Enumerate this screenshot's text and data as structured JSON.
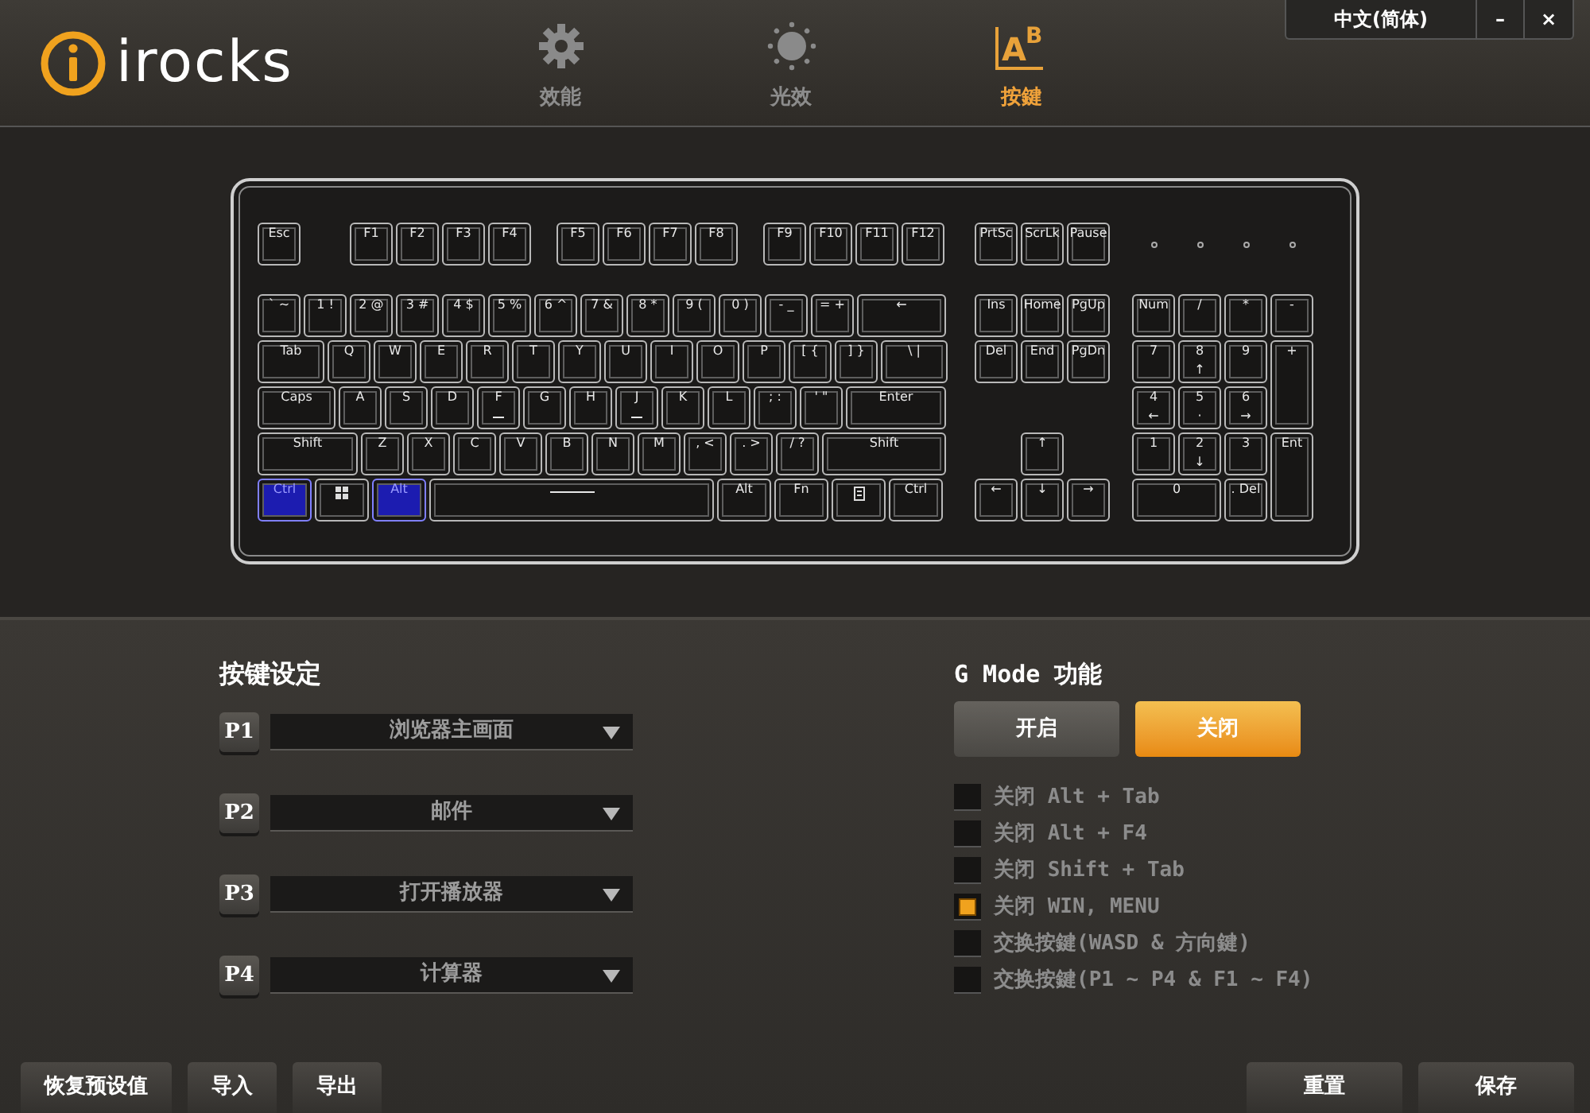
{
  "header": {
    "logo_text": "irocks",
    "tabs": [
      {
        "label": "效能",
        "kind": "gear",
        "selected": false
      },
      {
        "label": "光效",
        "kind": "sun",
        "selected": false
      },
      {
        "label": "按鍵",
        "kind": "letters",
        "icon_letters": [
          "A",
          "B"
        ],
        "selected": true
      }
    ],
    "language": "中文(简体)",
    "minimize": "–",
    "close": "×"
  },
  "keyboard": {
    "function_groups": [
      [
        {
          "label": "Esc",
          "kind": "std",
          "selected": false
        }
      ],
      [
        {
          "label": "F1",
          "kind": "std",
          "selected": false
        },
        {
          "label": "F2",
          "kind": "std",
          "selected": false
        },
        {
          "label": "F3",
          "kind": "std",
          "selected": false
        },
        {
          "label": "F4",
          "kind": "std",
          "selected": false
        }
      ],
      [
        {
          "label": "F5",
          "kind": "std",
          "selected": false
        },
        {
          "label": "F6",
          "kind": "std",
          "selected": false
        },
        {
          "label": "F7",
          "kind": "std",
          "selected": false
        },
        {
          "label": "F8",
          "kind": "std",
          "selected": false
        }
      ],
      [
        {
          "label": "F9",
          "kind": "std",
          "selected": false
        },
        {
          "label": "F10",
          "kind": "std",
          "selected": false
        },
        {
          "label": "F11",
          "kind": "std",
          "selected": false
        },
        {
          "label": "F12",
          "kind": "std",
          "selected": false
        }
      ]
    ],
    "system_keys": [
      {
        "label": "PrtSc",
        "kind": "std",
        "selected": false
      },
      {
        "label": "ScrLk",
        "kind": "std",
        "selected": false
      },
      {
        "label": "Pause",
        "kind": "std",
        "selected": false
      }
    ],
    "main_rows": [
      [
        {
          "label": "` ~",
          "kind": "std",
          "selected": false
        },
        {
          "label": "1 !",
          "kind": "std",
          "selected": false
        },
        {
          "label": "2 @",
          "kind": "std",
          "selected": false
        },
        {
          "label": "3 #",
          "kind": "std",
          "selected": false
        },
        {
          "label": "4 $",
          "kind": "std",
          "selected": false
        },
        {
          "label": "5 %",
          "kind": "std",
          "selected": false
        },
        {
          "label": "6 ^",
          "kind": "std",
          "selected": false
        },
        {
          "label": "7 &",
          "kind": "std",
          "selected": false
        },
        {
          "label": "8 *",
          "kind": "std",
          "selected": false
        },
        {
          "label": "9 (",
          "kind": "std",
          "selected": false
        },
        {
          "label": "0 )",
          "kind": "std",
          "selected": false
        },
        {
          "label": "- _",
          "kind": "std",
          "selected": false
        },
        {
          "label": "= +",
          "kind": "std",
          "selected": false
        },
        {
          "label": "←",
          "kind": "backspace",
          "selected": false
        }
      ],
      [
        {
          "label": "Tab",
          "kind": "tab",
          "selected": false
        },
        {
          "label": "Q",
          "kind": "std",
          "selected": false
        },
        {
          "label": "W",
          "kind": "std",
          "selected": false
        },
        {
          "label": "E",
          "kind": "std",
          "selected": false
        },
        {
          "label": "R",
          "kind": "std",
          "selected": false
        },
        {
          "label": "T",
          "kind": "std",
          "selected": false
        },
        {
          "label": "Y",
          "kind": "std",
          "selected": false
        },
        {
          "label": "U",
          "kind": "std",
          "selected": false
        },
        {
          "label": "I",
          "kind": "std",
          "selected": false
        },
        {
          "label": "O",
          "kind": "std",
          "selected": false
        },
        {
          "label": "P",
          "kind": "std",
          "selected": false
        },
        {
          "label": "[ {",
          "kind": "std",
          "selected": false
        },
        {
          "label": "] }",
          "kind": "std",
          "selected": false
        },
        {
          "label": "\\ |",
          "kind": "backslash",
          "selected": false
        }
      ],
      [
        {
          "label": "Caps",
          "kind": "caps",
          "selected": false
        },
        {
          "label": "A",
          "kind": "std",
          "selected": false
        },
        {
          "label": "S",
          "kind": "std",
          "selected": false
        },
        {
          "label": "D",
          "kind": "std",
          "selected": false
        },
        {
          "label": "F",
          "kind": "home",
          "selected": false
        },
        {
          "label": "G",
          "kind": "std",
          "selected": false
        },
        {
          "label": "H",
          "kind": "std",
          "selected": false
        },
        {
          "label": "J",
          "kind": "home",
          "selected": false
        },
        {
          "label": "K",
          "kind": "std",
          "selected": false
        },
        {
          "label": "L",
          "kind": "std",
          "selected": false
        },
        {
          "label": "; :",
          "kind": "std",
          "selected": false
        },
        {
          "label": "' \"",
          "kind": "std",
          "selected": false
        },
        {
          "label": "Enter",
          "kind": "enter",
          "selected": false
        }
      ],
      [
        {
          "label": "Shift",
          "kind": "lshift",
          "selected": false
        },
        {
          "label": "Z",
          "kind": "std",
          "selected": false
        },
        {
          "label": "X",
          "kind": "std",
          "selected": false
        },
        {
          "label": "C",
          "kind": "std",
          "selected": false
        },
        {
          "label": "V",
          "kind": "std",
          "selected": false
        },
        {
          "label": "B",
          "kind": "std",
          "selected": false
        },
        {
          "label": "N",
          "kind": "std",
          "selected": false
        },
        {
          "label": "M",
          "kind": "std",
          "selected": false
        },
        {
          "label": ", <",
          "kind": "std",
          "selected": false
        },
        {
          "label": ". >",
          "kind": "std",
          "selected": false
        },
        {
          "label": "/ ?",
          "kind": "std",
          "selected": false
        },
        {
          "label": "Shift",
          "kind": "rshift",
          "selected": false
        }
      ],
      [
        {
          "label": "Ctrl",
          "kind": "mod",
          "selected": true
        },
        {
          "kind": "win",
          "selected": false
        },
        {
          "label": "Alt",
          "kind": "mod",
          "selected": true
        },
        {
          "kind": "space",
          "selected": false
        },
        {
          "label": "Alt",
          "kind": "mod",
          "selected": false
        },
        {
          "label": "Fn",
          "kind": "mod",
          "selected": false
        },
        {
          "kind": "menu",
          "selected": false
        },
        {
          "label": "Ctrl",
          "kind": "mod",
          "selected": false
        }
      ]
    ],
    "nav_rows": [
      [
        {
          "label": "Ins",
          "kind": "std",
          "selected": false
        },
        {
          "label": "Home",
          "kind": "std",
          "selected": false
        },
        {
          "label": "PgUp",
          "kind": "std",
          "selected": false
        }
      ],
      [
        {
          "label": "Del",
          "kind": "std",
          "selected": false
        },
        {
          "label": "End",
          "kind": "std",
          "selected": false
        },
        {
          "label": "PgDn",
          "kind": "std",
          "selected": false
        }
      ]
    ],
    "arrow_rows": [
      [
        {
          "label": "↑",
          "kind": "std",
          "selected": false
        }
      ],
      [
        {
          "label": "←",
          "kind": "std",
          "selected": false
        },
        {
          "label": "↓",
          "kind": "std",
          "selected": false
        },
        {
          "label": "→",
          "kind": "std",
          "selected": false
        }
      ]
    ],
    "numpad": [
      {
        "label": "Num",
        "kind": "std",
        "selected": false
      },
      {
        "label": "/",
        "kind": "std",
        "selected": false
      },
      {
        "label": "*",
        "kind": "std",
        "selected": false
      },
      {
        "label": "-",
        "kind": "std",
        "selected": false
      },
      {
        "label": "7",
        "kind": "std",
        "selected": false
      },
      {
        "label": "8",
        "sub": "↑",
        "kind": "std",
        "selected": false
      },
      {
        "label": "9",
        "kind": "std",
        "selected": false
      },
      {
        "label": "+",
        "kind": "tall",
        "selected": false
      },
      {
        "label": "4",
        "sub": "←",
        "kind": "std",
        "selected": false
      },
      {
        "label": "5",
        "sub": "·",
        "kind": "std",
        "selected": false
      },
      {
        "label": "6",
        "sub": "→",
        "kind": "std",
        "selected": false
      },
      {
        "label": "1",
        "kind": "std",
        "selected": false
      },
      {
        "label": "2",
        "sub": "↓",
        "kind": "std",
        "selected": false
      },
      {
        "label": "3",
        "kind": "std",
        "selected": false
      },
      {
        "label": "Ent",
        "kind": "tall",
        "selected": false
      },
      {
        "label": "0",
        "kind": "zero",
        "selected": false
      },
      {
        "label": ". Del",
        "kind": "std",
        "selected": false
      }
    ]
  },
  "key_settings": {
    "title": "按键设定",
    "rows": [
      {
        "badge": "P1",
        "value": "浏览器主画面"
      },
      {
        "badge": "P2",
        "value": "邮件"
      },
      {
        "badge": "P3",
        "value": "打开播放器"
      },
      {
        "badge": "P4",
        "value": "计算器"
      }
    ]
  },
  "g_mode": {
    "title": "G Mode 功能",
    "buttons": [
      {
        "label": "开启",
        "selected": false
      },
      {
        "label": "关闭",
        "selected": true
      }
    ],
    "options": [
      {
        "label": "关闭 Alt + Tab",
        "checked": false
      },
      {
        "label": "关闭 Alt + F4",
        "checked": false
      },
      {
        "label": "关闭 Shift + Tab",
        "checked": false
      },
      {
        "label": "关闭 WIN, MENU",
        "checked": true
      },
      {
        "label": "交换按鍵(WASD & 方向鍵)",
        "checked": false
      },
      {
        "label": "交换按鍵(P1 ~ P4 & F1 ~ F4)",
        "checked": false
      }
    ]
  },
  "footer": {
    "left_buttons": [
      "恢复预设值",
      "导入",
      "导出"
    ],
    "right_buttons": [
      "重置",
      "保存"
    ]
  }
}
